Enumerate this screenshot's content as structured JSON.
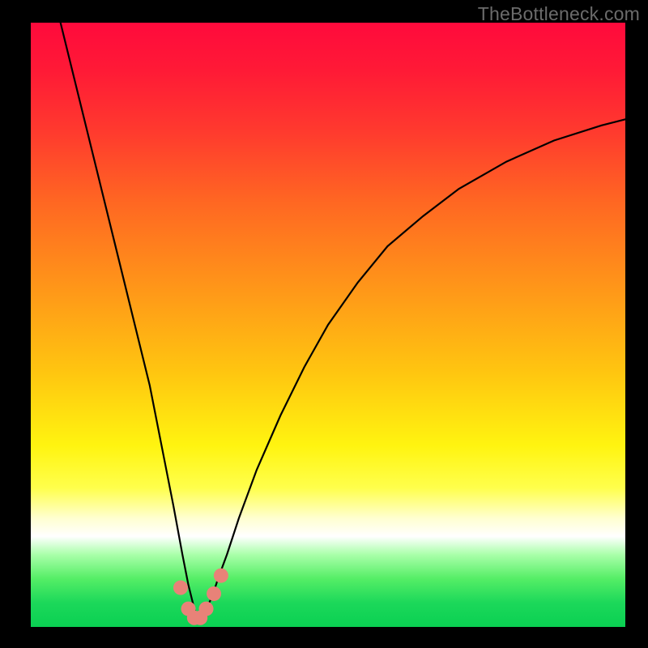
{
  "watermark": "TheBottleneck.com",
  "chart_data": {
    "type": "line",
    "title": "",
    "xlabel": "",
    "ylabel": "",
    "xlim": [
      0,
      100
    ],
    "ylim": [
      0,
      100
    ],
    "series": [
      {
        "name": "curve",
        "x": [
          5,
          8,
          11,
          14,
          17,
          20,
          22,
          24,
          25.5,
          26.5,
          27.5,
          28,
          28.5,
          29.5,
          30.5,
          31.5,
          33,
          35,
          38,
          42,
          46,
          50,
          55,
          60,
          66,
          72,
          80,
          88,
          96,
          100
        ],
        "y": [
          100,
          88,
          76,
          64,
          52,
          40,
          30,
          20,
          12,
          7,
          3,
          1.5,
          1.5,
          3,
          5,
          8,
          12,
          18,
          26,
          35,
          43,
          50,
          57,
          63,
          68,
          72.5,
          77,
          80.5,
          83,
          84
        ]
      }
    ],
    "markers": {
      "name": "floor-dots",
      "x": [
        25.2,
        26.5,
        27.5,
        28.5,
        29.5,
        30.8,
        32.0
      ],
      "y": [
        6.5,
        3.0,
        1.5,
        1.5,
        3.0,
        5.5,
        8.5
      ]
    },
    "colors": {
      "curve": "#000000",
      "markers": "#e88278"
    }
  }
}
